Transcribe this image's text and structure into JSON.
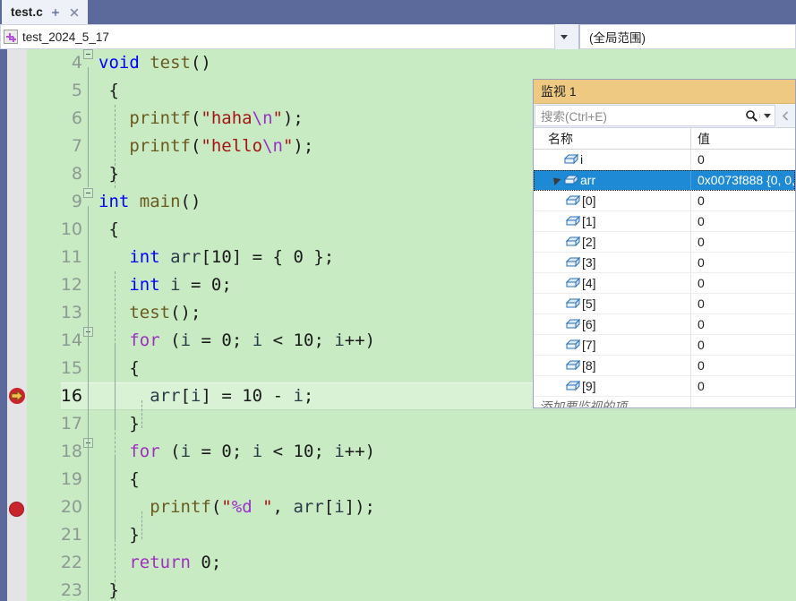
{
  "window": {
    "tab": {
      "title": "test.c",
      "pin_icon": "pin-icon",
      "close_icon": "close-icon"
    }
  },
  "navbar": {
    "project_icon": "project-icon",
    "project": "test_2024_5_17",
    "scope": "(全局范围)",
    "dropdown_icon": "chevron-down-icon"
  },
  "editor": {
    "first_line": 4,
    "current_line": 16,
    "breakpoint_line": 20,
    "bg": "#c8ebc4",
    "current_line_bg": "#d9f2d6",
    "lines": [
      {
        "n": 4,
        "text": "void test()"
      },
      {
        "n": 5,
        "text": "{"
      },
      {
        "n": 6,
        "text": "    printf(\"haha\\n\");"
      },
      {
        "n": 7,
        "text": "    printf(\"hello\\n\");"
      },
      {
        "n": 8,
        "text": "}"
      },
      {
        "n": 9,
        "text": "int main()"
      },
      {
        "n": 10,
        "text": "{"
      },
      {
        "n": 11,
        "text": "    int arr[10] = { 0 };"
      },
      {
        "n": 12,
        "text": "    int i = 0;"
      },
      {
        "n": 13,
        "text": "    test();"
      },
      {
        "n": 14,
        "text": "    for (i = 0; i < 10; i++)"
      },
      {
        "n": 15,
        "text": "    {"
      },
      {
        "n": 16,
        "text": "        arr[i] = 10 - i;"
      },
      {
        "n": 17,
        "text": "    }"
      },
      {
        "n": 18,
        "text": "    for (i = 0; i < 10; i++)"
      },
      {
        "n": 19,
        "text": "    {"
      },
      {
        "n": 20,
        "text": "        printf(\"%d \", arr[i]);"
      },
      {
        "n": 21,
        "text": "    }"
      },
      {
        "n": 22,
        "text": "    return 0;"
      },
      {
        "n": 23,
        "text": "}"
      }
    ],
    "markers": {
      "execution_pointer_icon": "execution-arrow-icon",
      "breakpoint_icon": "breakpoint-icon"
    }
  },
  "watch": {
    "title": "监视 1",
    "search": {
      "placeholder": "搜索(Ctrl+E)",
      "icon": "search-icon",
      "dropdown_icon": "chevron-down-icon"
    },
    "columns": {
      "name": "名称",
      "value": "值"
    },
    "add_placeholder": "添加要监视的项",
    "selected_row": "arr",
    "rows": [
      {
        "name": "i",
        "value": "0",
        "indent": 1,
        "expandable": false,
        "selected": false
      },
      {
        "name": "arr",
        "value": "0x0073f888 {0, 0,",
        "indent": 1,
        "expandable": true,
        "expanded": true,
        "selected": true
      },
      {
        "name": "[0]",
        "value": "0",
        "indent": 2,
        "expandable": false,
        "selected": false
      },
      {
        "name": "[1]",
        "value": "0",
        "indent": 2,
        "expandable": false,
        "selected": false
      },
      {
        "name": "[2]",
        "value": "0",
        "indent": 2,
        "expandable": false,
        "selected": false
      },
      {
        "name": "[3]",
        "value": "0",
        "indent": 2,
        "expandable": false,
        "selected": false
      },
      {
        "name": "[4]",
        "value": "0",
        "indent": 2,
        "expandable": false,
        "selected": false
      },
      {
        "name": "[5]",
        "value": "0",
        "indent": 2,
        "expandable": false,
        "selected": false
      },
      {
        "name": "[6]",
        "value": "0",
        "indent": 2,
        "expandable": false,
        "selected": false
      },
      {
        "name": "[7]",
        "value": "0",
        "indent": 2,
        "expandable": false,
        "selected": false
      },
      {
        "name": "[8]",
        "value": "0",
        "indent": 2,
        "expandable": false,
        "selected": false
      },
      {
        "name": "[9]",
        "value": "0",
        "indent": 2,
        "expandable": false,
        "selected": false
      }
    ]
  }
}
